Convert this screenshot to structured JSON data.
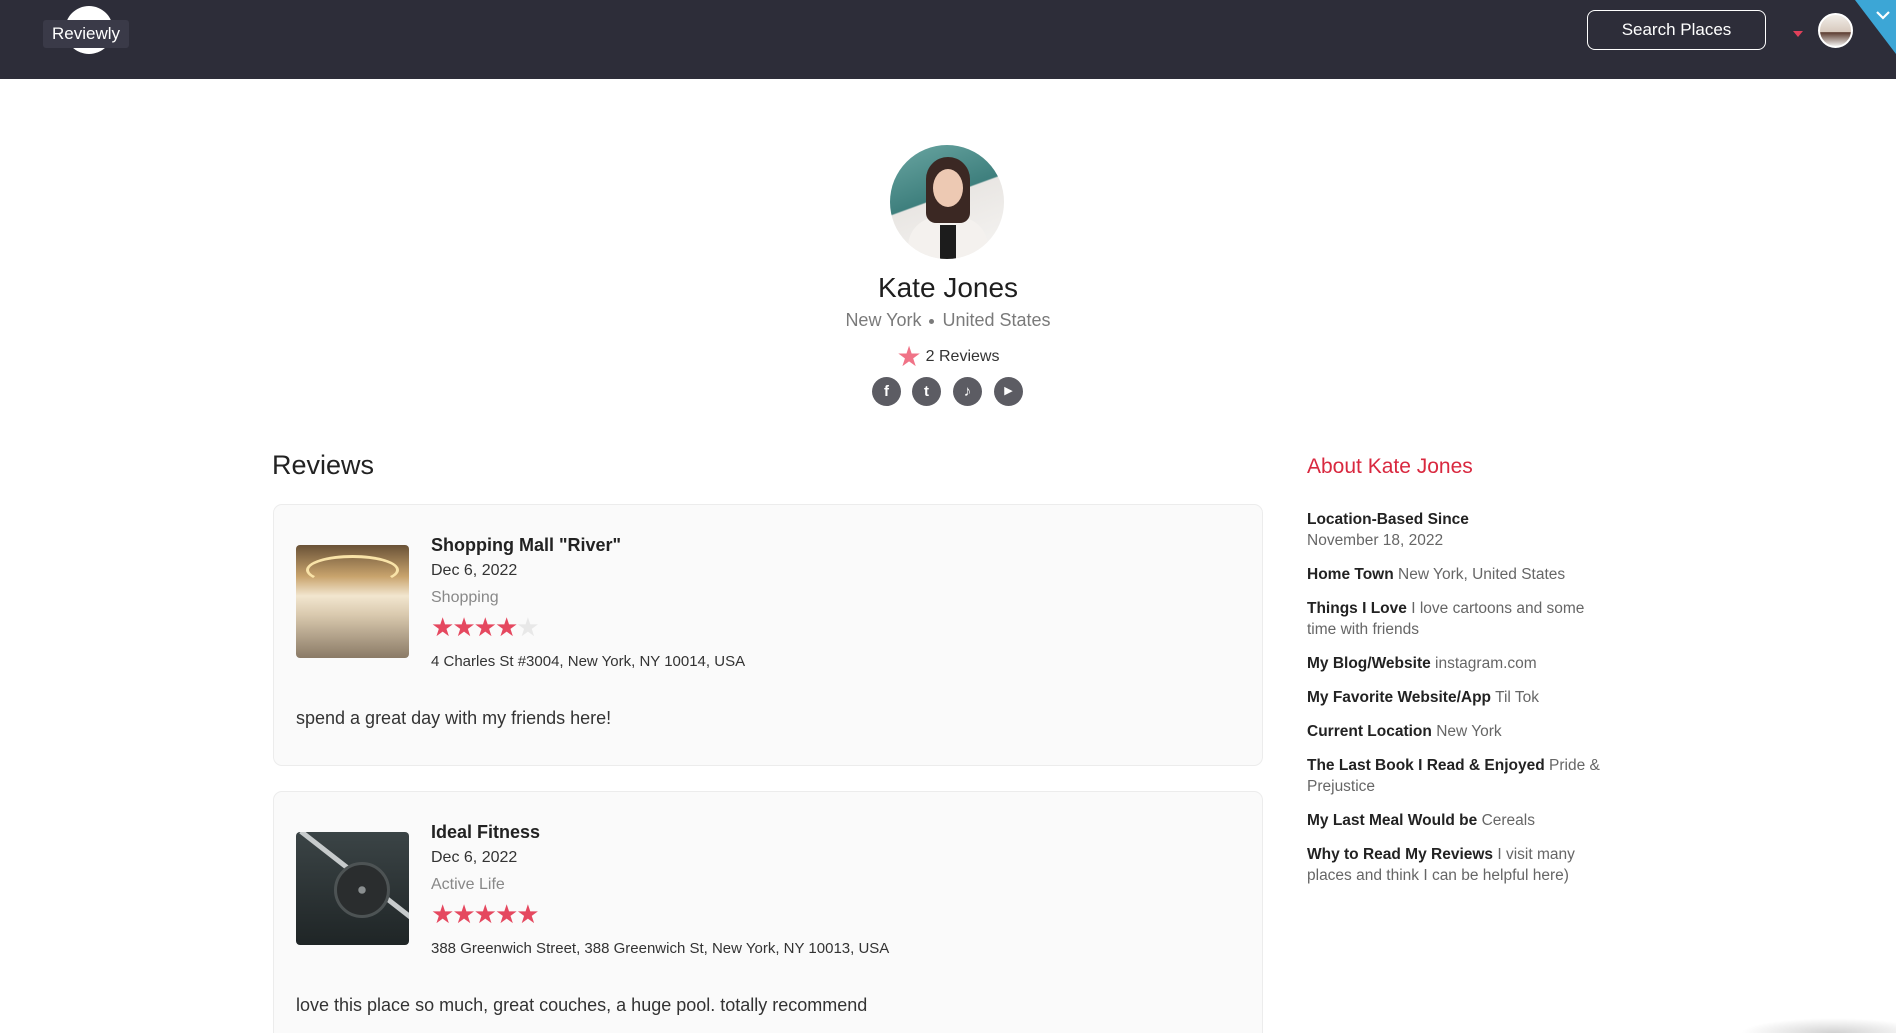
{
  "header": {
    "logo_text": "Reviewly",
    "search_label": "Search Places"
  },
  "profile": {
    "name": "Kate Jones",
    "city": "New York",
    "country": "United States",
    "review_count": "2 Reviews",
    "socials": [
      {
        "name": "facebook-icon",
        "glyph": "f"
      },
      {
        "name": "twitter-icon",
        "glyph": "t"
      },
      {
        "name": "tiktok-icon",
        "glyph": "♪"
      },
      {
        "name": "youtube-icon",
        "glyph": "▶"
      }
    ]
  },
  "reviews": {
    "title": "Reviews",
    "items": [
      {
        "place": "Shopping Mall \"River\"",
        "date": "Dec 6, 2022",
        "category": "Shopping",
        "rating": 4,
        "address": "4 Charles St #3004, New York, NY 10014, USA",
        "text": "spend a great day with my friends here!"
      },
      {
        "place": "Ideal Fitness",
        "date": "Dec 6, 2022",
        "category": "Active Life",
        "rating": 5,
        "address": "388 Greenwich Street, 388 Greenwich St, New York, NY 10013, USA",
        "text": "love this place so much, great couches, a huge pool. totally recommend"
      }
    ]
  },
  "about": {
    "title": "About Kate Jones",
    "items": [
      {
        "label": "Location-Based Since",
        "value": "November 18, 2022"
      },
      {
        "label": "Home Town",
        "value": "New York, United States"
      },
      {
        "label": "Things I Love",
        "value": "I love cartoons and some time with friends"
      },
      {
        "label": "My Blog/Website",
        "value": "instagram.com"
      },
      {
        "label": "My Favorite Website/App",
        "value": "Til Tok"
      },
      {
        "label": "Current Location",
        "value": "New York"
      },
      {
        "label": "The Last Book I Read & Enjoyed",
        "value": "Pride & Prejustice"
      },
      {
        "label": "My Last Meal Would be",
        "value": "Cereals"
      },
      {
        "label": "Why to Read My Reviews",
        "value": "I visit many places and think I can be helpful here)"
      }
    ]
  },
  "colors": {
    "header_bg": "#2d2d39",
    "accent": "#d9283f",
    "star": "#e5485f",
    "corner": "#3ca6d6"
  }
}
